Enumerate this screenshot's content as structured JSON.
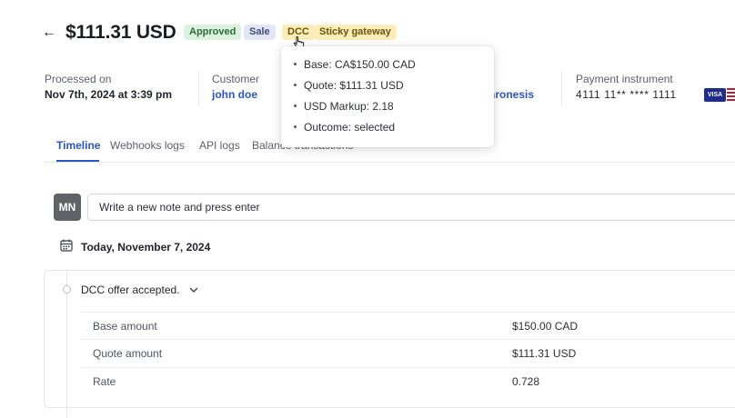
{
  "header": {
    "back_glyph": "←",
    "amount": "$111.31 USD",
    "badges": {
      "approved": "Approved",
      "sale": "Sale",
      "dcc": "DCC",
      "sticky": "Sticky gateway"
    }
  },
  "info": {
    "processed_label": "Processed on",
    "processed_value": "Nov 7th, 2024 at 3:39 pm",
    "customer_label": "Customer",
    "customer_value": "john doe",
    "partial_link": "hronesis",
    "payment_label": "Payment instrument",
    "payment_value": "4111 11** **** 1111",
    "card_brand": "VISA"
  },
  "tooltip": {
    "items": [
      "Base: CA$150.00 CAD",
      "Quote: $111.31 USD",
      "USD Markup: 2.18",
      "Outcome: selected"
    ]
  },
  "tabs": [
    {
      "label": "Timeline",
      "active": true
    },
    {
      "label": "Webhooks logs",
      "active": false
    },
    {
      "label": "API logs",
      "active": false
    },
    {
      "label": "Balance transactions",
      "active": false
    }
  ],
  "note": {
    "avatar_initials": "MN",
    "placeholder": "Write a new note and press enter"
  },
  "timeline": {
    "date": "Today, November 7, 2024",
    "event_title": "DCC offer accepted.",
    "rows": [
      {
        "label": "Base amount",
        "value": "$150.00 CAD"
      },
      {
        "label": "Quote amount",
        "value": "$111.31 USD"
      },
      {
        "label": "Rate",
        "value": "0.728"
      }
    ]
  },
  "colors": {
    "accent": "#2a54c8",
    "approved_bg": "#dcf2df",
    "sale_bg": "#e3e6f6",
    "warning_bg": "#fbecb8",
    "card_visa": "#1f2d8a"
  },
  "icons": {
    "back": "arrow-left-icon",
    "cursor": "cursor-pointer-icon",
    "calendar": "calendar-icon",
    "chevron": "chevron-down-icon",
    "timeline_dot": "timeline-dot-icon"
  }
}
